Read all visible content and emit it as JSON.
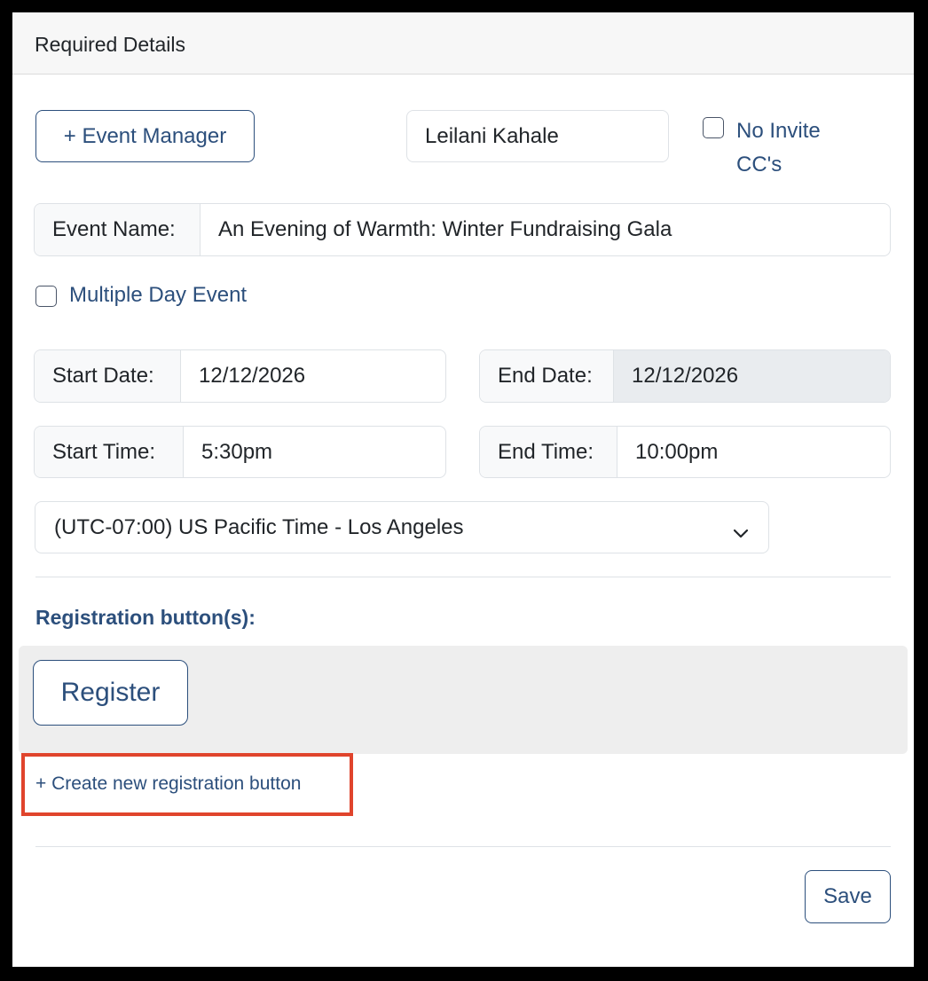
{
  "card": {
    "title": "Required Details"
  },
  "event_manager": {
    "add_button_label": "+ Event Manager",
    "name_value": "Leilani Kahale",
    "no_invite_ccs_label_line1": "No Invite",
    "no_invite_ccs_label_line2": "CC's",
    "no_invite_ccs_checked": false
  },
  "event_name": {
    "label": "Event Name:",
    "value": "An Evening of Warmth: Winter Fundraising Gala"
  },
  "multiple_day": {
    "label": "Multiple Day Event",
    "checked": false
  },
  "dates": {
    "start_label": "Start Date:",
    "start_value": "12/12/2026",
    "end_label": "End Date:",
    "end_value": "12/12/2026"
  },
  "times": {
    "start_label": "Start Time:",
    "start_value": "5:30pm",
    "end_label": "End Time:",
    "end_value": "10:00pm"
  },
  "timezone": {
    "selected": "(UTC-07:00) US Pacific Time - Los Angeles",
    "icon": "chevron-down-icon"
  },
  "registration": {
    "heading": "Registration button(s):",
    "buttons": [
      "Register"
    ],
    "create_link": "+ Create new registration button",
    "highlight_color": "#e0442c"
  },
  "footer": {
    "save_label": "Save"
  },
  "colors": {
    "accent": "#2c4f7c",
    "header_bg": "#f7f7f7",
    "registration_bg": "#eeeeee"
  }
}
